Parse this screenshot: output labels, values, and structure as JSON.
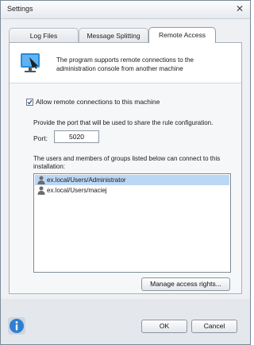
{
  "window": {
    "title": "Settings",
    "close_glyph": "✕"
  },
  "tabs": [
    {
      "label": "Log Files",
      "active": false
    },
    {
      "label": "Message Splitting",
      "active": false
    },
    {
      "label": "Remote Access",
      "active": true
    }
  ],
  "info": {
    "icon": "remote-monitor-icon",
    "text": "The program supports remote connections to the administration console from another machine"
  },
  "remote": {
    "allow_label": "Allow remote connections to this machine",
    "allow_checked": true,
    "port_description": "Provide the port that will be used to share the rule configuration.",
    "port_label": "Port:",
    "port_value": "5020"
  },
  "users": {
    "description": "The users and members of groups listed below can connect to this installation:",
    "items": [
      {
        "name": "ex.local/Users/Administrator",
        "selected": true
      },
      {
        "name": "ex.local/Users/maciej",
        "selected": false
      }
    ]
  },
  "buttons": {
    "manage": "Manage access rights...",
    "ok": "OK",
    "cancel": "Cancel"
  },
  "colors": {
    "accent": "#2f7fd1",
    "selection": "#bcd7f4"
  }
}
